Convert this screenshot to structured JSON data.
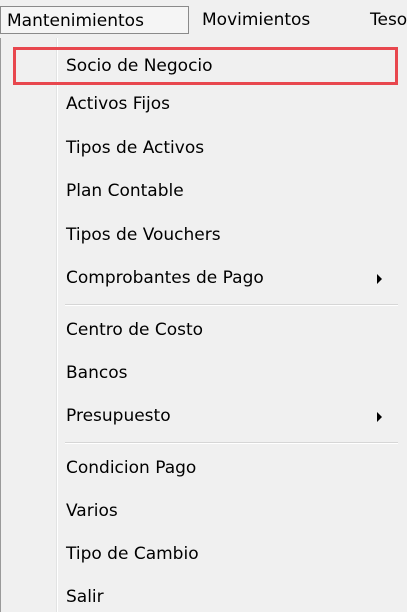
{
  "menubar": {
    "items": [
      "Mantenimientos",
      "Movimientos",
      "Teso"
    ]
  },
  "menu": {
    "groups": [
      [
        {
          "label": "Socio de Negocio",
          "submenu": false,
          "highlighted": true
        },
        {
          "label": "Activos Fijos",
          "submenu": false
        },
        {
          "label": "Tipos de Activos",
          "submenu": false
        },
        {
          "label": "Plan Contable",
          "submenu": false
        },
        {
          "label": "Tipos de Vouchers",
          "submenu": false
        },
        {
          "label": "Comprobantes de Pago",
          "submenu": true
        }
      ],
      [
        {
          "label": "Centro de Costo",
          "submenu": false
        },
        {
          "label": "Bancos",
          "submenu": false
        },
        {
          "label": "Presupuesto",
          "submenu": true
        }
      ],
      [
        {
          "label": "Condicion Pago",
          "submenu": false
        },
        {
          "label": "Varios",
          "submenu": false
        },
        {
          "label": "Tipo de Cambio",
          "submenu": false
        },
        {
          "label": "Salir",
          "submenu": false
        }
      ]
    ]
  },
  "colors": {
    "highlight_border": "#e8474e",
    "menu_bg": "#f0f0f0"
  }
}
